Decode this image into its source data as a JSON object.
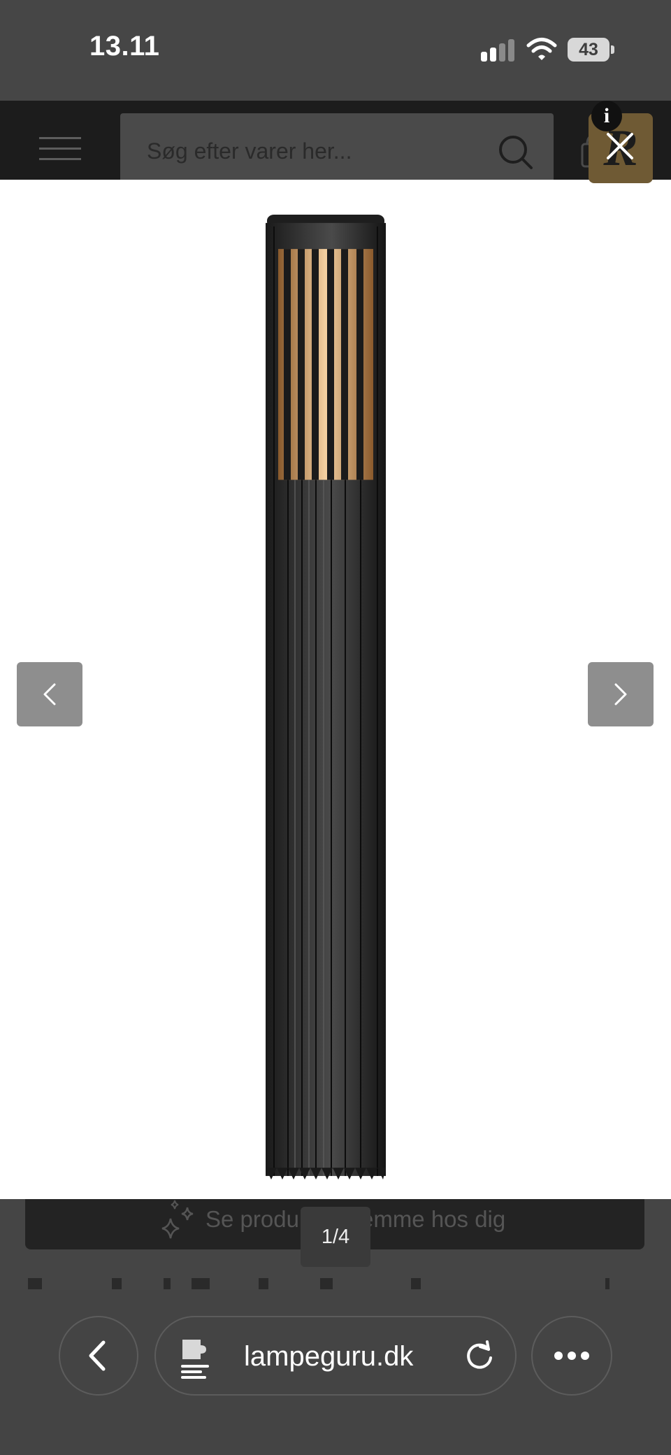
{
  "status_bar": {
    "time": "13.11",
    "battery": "43"
  },
  "header": {
    "search_placeholder": "Søg efter varer her...",
    "info_badge": "i",
    "brand_logo": "R"
  },
  "lightbox": {
    "counter": "1/4",
    "ar_text": "Se produktet hjemme hos dig"
  },
  "browser": {
    "address": "lampeguru.dk"
  },
  "colors": {
    "lightbox_bg": "#ffffff",
    "overlay": "#454545",
    "nav_button": "#8e8e8e",
    "lamp_body": "#2d2d2d",
    "lamp_glow": "#d99a5c"
  },
  "icons": {
    "status_signal": "cellular-signal-icon",
    "status_wifi": "wifi-icon",
    "menu": "hamburger-menu-icon",
    "search": "search-icon",
    "cart": "shopping-bag-icon",
    "close": "close-icon",
    "prev": "chevron-left-icon",
    "next": "chevron-right-icon",
    "ar": "sparkle-icon",
    "back": "chevron-left-icon",
    "extension": "puzzle-icon",
    "reload": "reload-icon",
    "more": "ellipsis-icon"
  }
}
